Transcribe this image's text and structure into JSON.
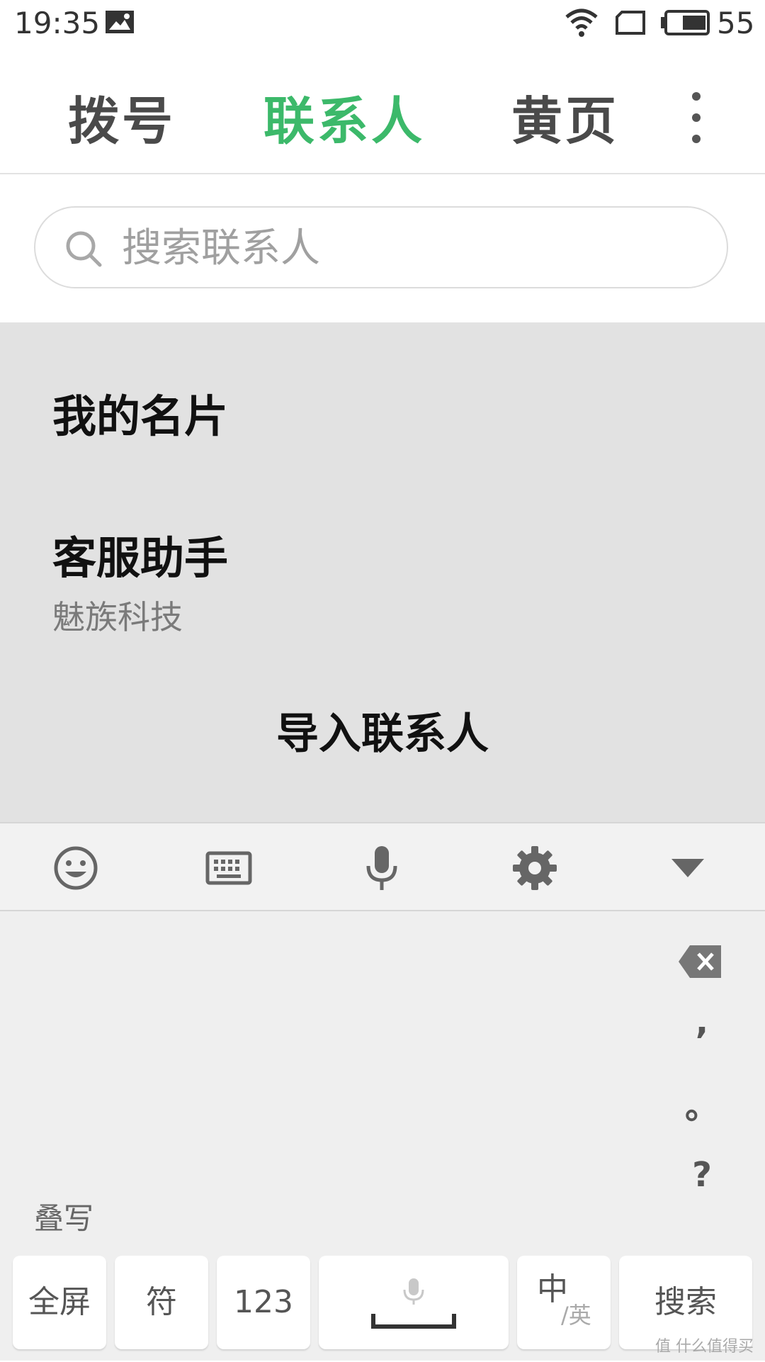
{
  "status_bar": {
    "time": "19:35",
    "battery_level": "55",
    "icons": [
      "image-notification-icon",
      "wifi-icon",
      "sim-card-icon",
      "battery-icon"
    ]
  },
  "tabs": [
    {
      "label": "拨号",
      "active": false
    },
    {
      "label": "联系人",
      "active": true
    },
    {
      "label": "黄页",
      "active": false
    }
  ],
  "colors": {
    "accent": "#3cb96a",
    "list_background": "#e2e2e2",
    "keyboard_background": "#efefef"
  },
  "search": {
    "placeholder": "搜索联系人"
  },
  "contacts": {
    "my_card": "我的名片",
    "service": {
      "name": "客服助手",
      "company": "魅族科技"
    },
    "import_label": "导入联系人"
  },
  "keyboard": {
    "toolbar_icons": [
      "emoji-icon",
      "keyboard-icon",
      "microphone-icon",
      "settings-icon",
      "collapse-icon"
    ],
    "side_keys": [
      ",",
      "。",
      "?"
    ],
    "overlay_label": "叠写",
    "bottom_keys": {
      "fullscreen": "全屏",
      "symbols": "符",
      "numbers": "123",
      "lang_main": "中",
      "lang_sub": "/英",
      "search": "搜索"
    }
  },
  "watermark": "值 什么值得买"
}
